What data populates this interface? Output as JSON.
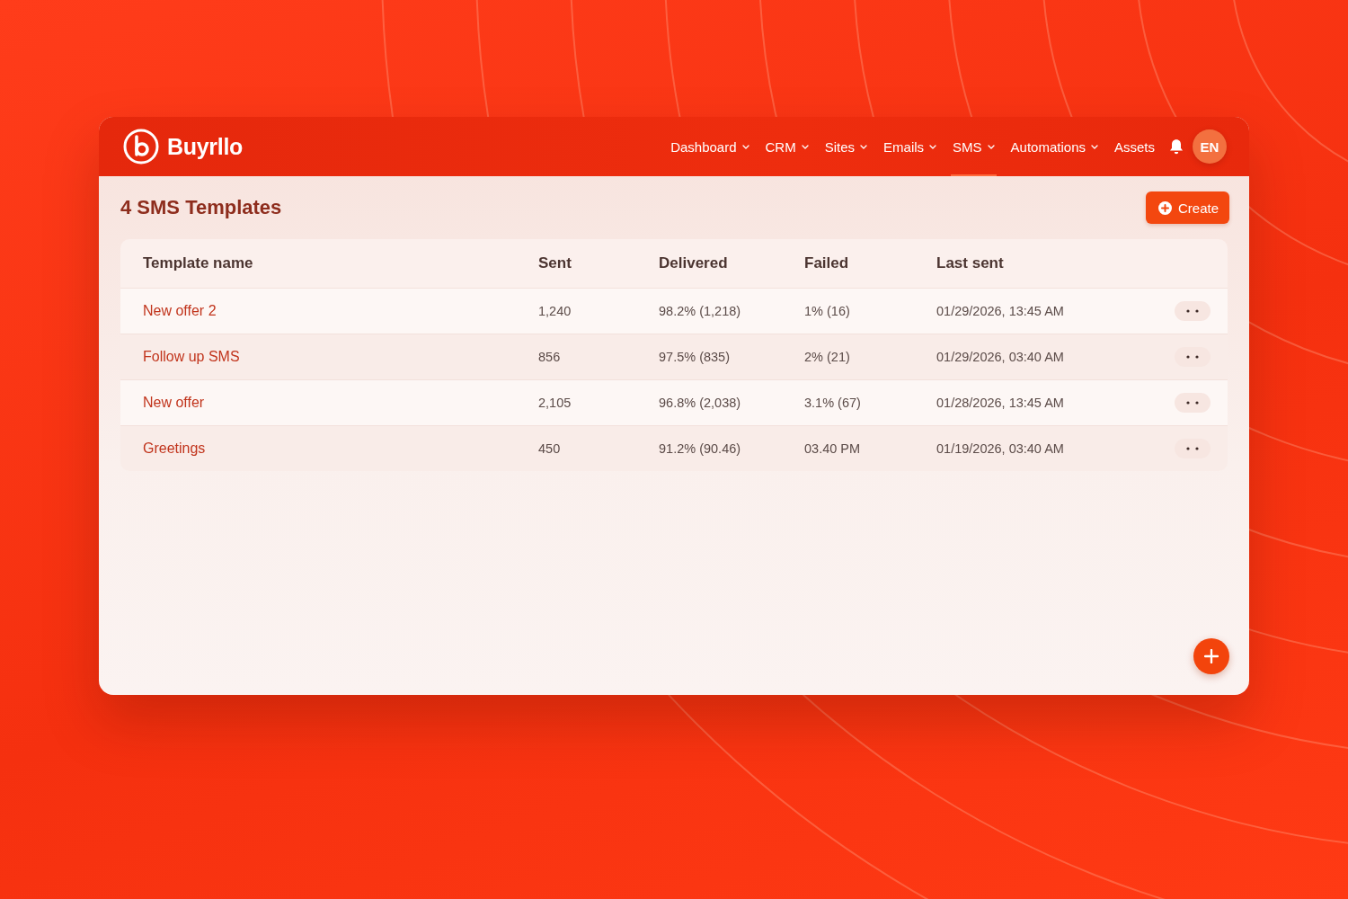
{
  "app": {
    "logo": "Buyrllo"
  },
  "nav": [
    {
      "label": "Dashboard",
      "dropdown": true,
      "selected": false
    },
    {
      "label": "CRM",
      "dropdown": true,
      "selected": false
    },
    {
      "label": "Sites",
      "dropdown": true,
      "selected": false
    },
    {
      "label": "Emails",
      "dropdown": true,
      "selected": false
    },
    {
      "label": "SMS",
      "dropdown": true,
      "selected": true
    },
    {
      "label": "Automations",
      "dropdown": true,
      "selected": false
    },
    {
      "label": "Assets",
      "dropdown": false,
      "selected": false
    }
  ],
  "user": {
    "avatar": "EN"
  },
  "page": {
    "title": "4 SMS Templates",
    "create_button": "Create"
  },
  "table": {
    "columns": [
      "Template name",
      "Sent",
      "Delivered",
      "Failed",
      "Last sent"
    ],
    "rows": [
      {
        "name": "New offer 2",
        "sent": "1,240",
        "delivered": "98.2% (1,218)",
        "failed": "1% (16)",
        "last_sent": "01/29/2026, 13:45 AM"
      },
      {
        "name": "Follow up SMS",
        "sent": "856",
        "delivered": "97.5% (835)",
        "failed": "2% (21)",
        "last_sent": "01/29/2026, 03:40 AM"
      },
      {
        "name": "New offer",
        "sent": "2,105",
        "delivered": "96.8% (2,038)",
        "failed": "3.1% (67)",
        "last_sent": "01/28/2026, 13:45 AM"
      },
      {
        "name": "Greetings",
        "sent": "450",
        "delivered": "91.2% (90.46)",
        "failed": "03.40 PM",
        "last_sent": "01/19/2026, 03:40 AM"
      }
    ]
  }
}
